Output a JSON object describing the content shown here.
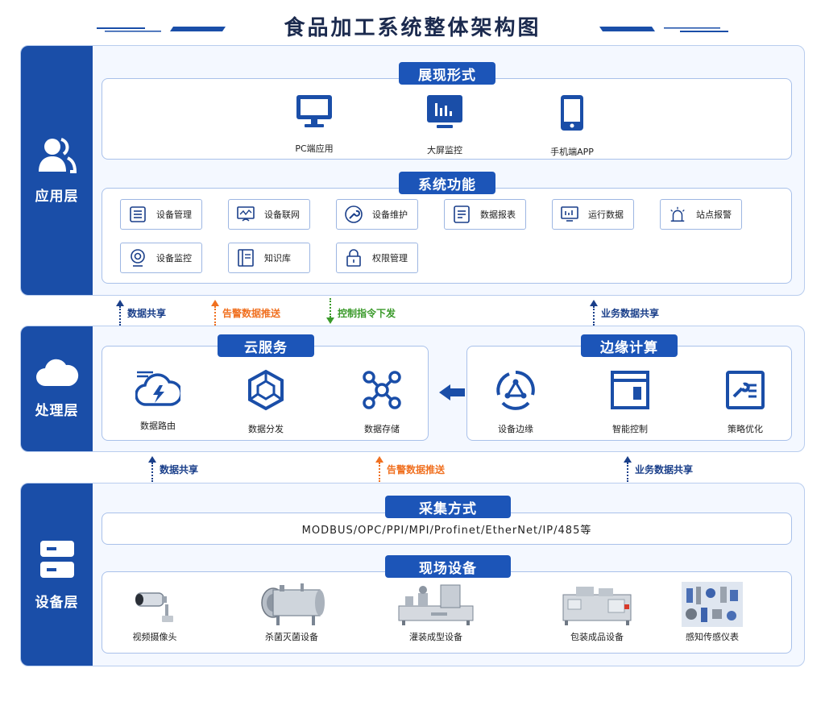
{
  "title": "食品加工系统整体架构图",
  "colors": {
    "primary": "#1a4ea8",
    "orange": "#f07020",
    "green": "#3a9a2a",
    "blue_text": "#1a3f8a"
  },
  "app_layer": {
    "label": "应用层",
    "icon": "users-icon",
    "display": {
      "title": "展现形式",
      "items": [
        {
          "label": "PC端应用",
          "icon": "monitor-icon"
        },
        {
          "label": "大屏监控",
          "icon": "dashboard-screen-icon"
        },
        {
          "label": "手机端APP",
          "icon": "mobile-phone-icon"
        }
      ]
    },
    "functions": {
      "title": "系统功能",
      "items": [
        {
          "label": "设备管理",
          "icon": "list-icon"
        },
        {
          "label": "设备联网",
          "icon": "network-icon"
        },
        {
          "label": "设备维护",
          "icon": "wrench-icon"
        },
        {
          "label": "数据报表",
          "icon": "report-icon"
        },
        {
          "label": "运行数据",
          "icon": "chart-monitor-icon"
        },
        {
          "label": "站点报警",
          "icon": "alarm-icon"
        },
        {
          "label": "设备监控",
          "icon": "camera-icon"
        },
        {
          "label": "知识库",
          "icon": "book-icon"
        },
        {
          "label": "权限管理",
          "icon": "lock-icon"
        }
      ]
    }
  },
  "arrows_top": [
    {
      "label": "数据共享",
      "direction": "up",
      "color": "#1a3f8a"
    },
    {
      "label": "告警数据推送",
      "direction": "up",
      "color": "#f07020"
    },
    {
      "label": "控制指令下发",
      "direction": "down",
      "color": "#3a9a2a"
    },
    {
      "label": "业务数据共享",
      "direction": "up",
      "color": "#1a3f8a"
    }
  ],
  "process_layer": {
    "label": "处理层",
    "icon": "cloud-icon",
    "cloud_service": {
      "title": "云服务",
      "items": [
        {
          "label": "数据路由",
          "icon": "cloud-bolt-icon"
        },
        {
          "label": "数据分发",
          "icon": "hexagon-network-icon"
        },
        {
          "label": "数据存储",
          "icon": "nodes-icon"
        }
      ]
    },
    "edge_computing": {
      "title": "边缘计算",
      "items": [
        {
          "label": "设备边缘",
          "icon": "edge-cycle-icon"
        },
        {
          "label": "智能控制",
          "icon": "window-control-icon"
        },
        {
          "label": "策略优化",
          "icon": "strategy-icon"
        }
      ]
    }
  },
  "arrows_bottom": [
    {
      "label": "数据共享",
      "direction": "up",
      "color": "#1a3f8a"
    },
    {
      "label": "告警数据推送",
      "direction": "up",
      "color": "#f07020"
    },
    {
      "label": "业务数据共享",
      "direction": "up",
      "color": "#1a3f8a"
    }
  ],
  "device_layer": {
    "label": "设备层",
    "icon": "server-icon",
    "collection": {
      "title": "采集方式",
      "protocols": "MODBUS/OPC/PPI/MPI/Profinet/EtherNet/IP/485等"
    },
    "field_devices": {
      "title": "现场设备",
      "items": [
        {
          "label": "视频摄像头",
          "icon": "cctv-camera-icon"
        },
        {
          "label": "杀菌灭菌设备",
          "icon": "sterilizer-icon"
        },
        {
          "label": "灌装成型设备",
          "icon": "filling-machine-icon"
        },
        {
          "label": "包装成品设备",
          "icon": "packaging-machine-icon"
        },
        {
          "label": "感知传感仪表",
          "icon": "sensors-icon"
        }
      ]
    }
  }
}
